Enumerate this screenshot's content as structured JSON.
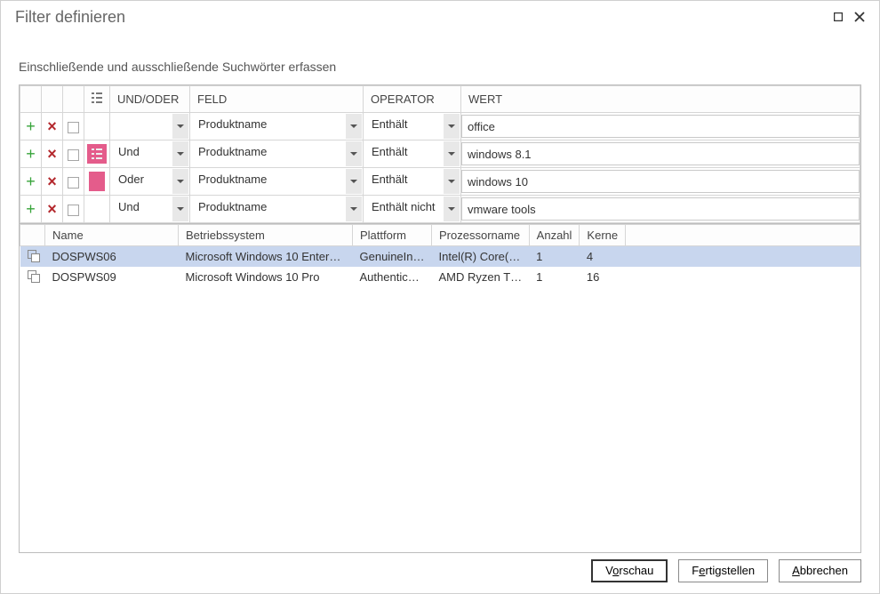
{
  "window": {
    "title": "Filter definieren"
  },
  "subtitle": "Einschließende und ausschließende Suchwörter erfassen",
  "filter_headers": {
    "andor": "UND/ODER",
    "field": "FELD",
    "operator": "OPERATOR",
    "value": "WERT"
  },
  "filter_rows": [
    {
      "pink": "none",
      "andor": "",
      "field": "Produktname",
      "operator": "Enthält",
      "value": "office"
    },
    {
      "pink": "badge",
      "andor": "Und",
      "field": "Produktname",
      "operator": "Enthält",
      "value": "windows 8.1"
    },
    {
      "pink": "square",
      "andor": "Oder",
      "field": "Produktname",
      "operator": "Enthält",
      "value": "windows 10"
    },
    {
      "pink": "none",
      "andor": "Und",
      "field": "Produktname",
      "operator": "Enthält nicht",
      "value": "vmware tools"
    }
  ],
  "result_headers": {
    "name": "Name",
    "os": "Betriebssystem",
    "platform": "Plattform",
    "processor": "Prozessorname",
    "count": "Anzahl",
    "cores": "Kerne"
  },
  "result_rows": [
    {
      "sel": true,
      "name": "DOSPWS06",
      "os": "Microsoft Windows 10 Enter…",
      "platform": "GenuineIn…",
      "processor": "Intel(R) Core(…",
      "count": "1",
      "cores": "4"
    },
    {
      "sel": false,
      "name": "DOSPWS09",
      "os": "Microsoft Windows 10 Pro",
      "platform": "Authentic…",
      "processor": "AMD Ryzen T…",
      "count": "1",
      "cores": "16"
    }
  ],
  "buttons": {
    "preview_pre": "V",
    "preview_accel": "o",
    "preview_post": "rschau",
    "finish_pre": "F",
    "finish_accel": "e",
    "finish_post": "rtigstellen",
    "cancel_pre": "",
    "cancel_accel": "A",
    "cancel_post": "bbrechen"
  }
}
